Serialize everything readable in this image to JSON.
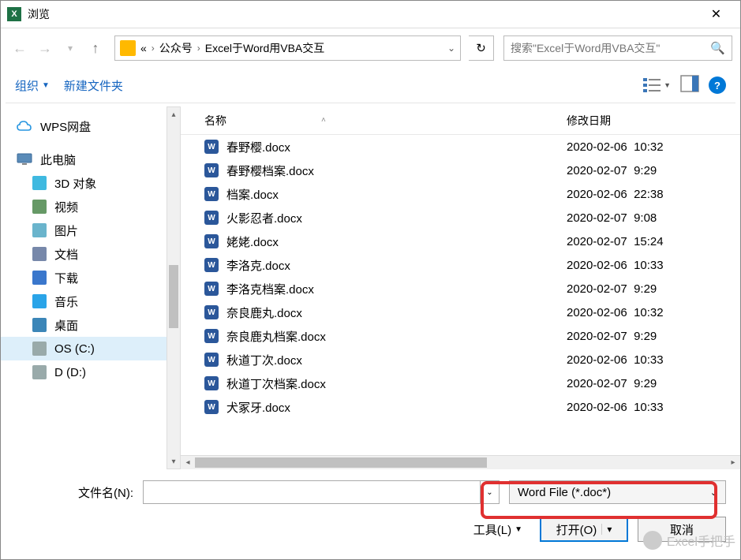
{
  "window": {
    "title": "浏览",
    "close_symbol": "✕"
  },
  "nav": {
    "back": "←",
    "forward": "→",
    "up": "↑",
    "refresh": "↻",
    "folder_root_glyph": "«",
    "crumbs": [
      "公众号",
      "Excel于Word用VBA交互"
    ],
    "search_placeholder": "搜索\"Excel于Word用VBA交互\""
  },
  "toolbar": {
    "organize": "组织",
    "new_folder": "新建文件夹"
  },
  "sidebar": {
    "wps": "WPS网盘",
    "this_pc": "此电脑",
    "items": [
      {
        "label": "3D 对象",
        "color": "#3fb9e0"
      },
      {
        "label": "视频",
        "color": "#696"
      },
      {
        "label": "图片",
        "color": "#6ab4cc"
      },
      {
        "label": "文档",
        "color": "#78a"
      },
      {
        "label": "下载",
        "color": "#3a77cc"
      },
      {
        "label": "音乐",
        "color": "#2aa4e8"
      },
      {
        "label": "桌面",
        "color": "#3b86b8"
      },
      {
        "label": "OS (C:)",
        "color": "#9aa"
      },
      {
        "label": "D (D:)",
        "color": "#9aa"
      }
    ],
    "selected_index": 7
  },
  "columns": {
    "name": "名称",
    "modified": "修改日期"
  },
  "files": [
    {
      "name": "春野樱.docx",
      "date": "2020-02-06  10:32"
    },
    {
      "name": "春野樱档案.docx",
      "date": "2020-02-07  9:29"
    },
    {
      "name": "档案.docx",
      "date": "2020-02-06  22:38"
    },
    {
      "name": "火影忍者.docx",
      "date": "2020-02-07  9:08"
    },
    {
      "name": "姥姥.docx",
      "date": "2020-02-07  15:24"
    },
    {
      "name": "李洛克.docx",
      "date": "2020-02-06  10:33"
    },
    {
      "name": "李洛克档案.docx",
      "date": "2020-02-07  9:29"
    },
    {
      "name": "奈良鹿丸.docx",
      "date": "2020-02-06  10:32"
    },
    {
      "name": "奈良鹿丸档案.docx",
      "date": "2020-02-07  9:29"
    },
    {
      "name": "秋道丁次.docx",
      "date": "2020-02-06  10:33"
    },
    {
      "name": "秋道丁次档案.docx",
      "date": "2020-02-07  9:29"
    },
    {
      "name": "犬冢牙.docx",
      "date": "2020-02-06  10:33"
    }
  ],
  "bottom": {
    "filename_label": "文件名(N):",
    "filename_value": "",
    "filter": "Word File (*.doc*)",
    "tools": "工具(L)",
    "open": "打开(O)",
    "cancel": "取消"
  },
  "watermark": {
    "text": "Excel手把手"
  }
}
